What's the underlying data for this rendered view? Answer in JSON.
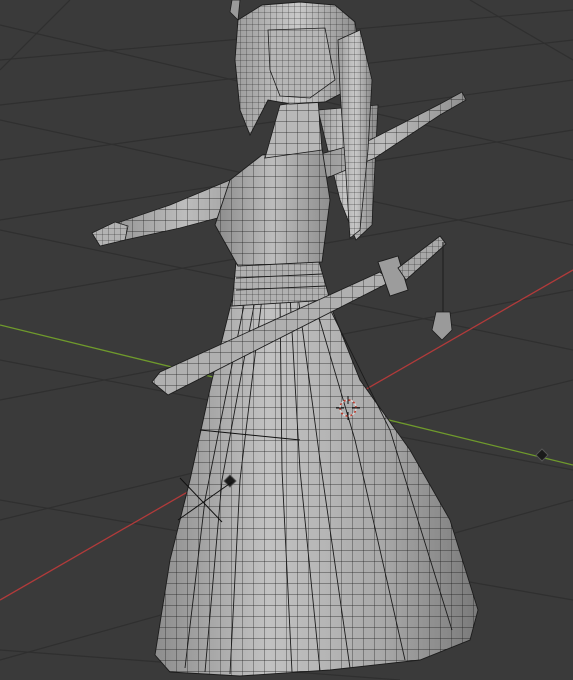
{
  "viewport": {
    "background": "#3a3a3a",
    "grid_color": "#2f2f2f",
    "axis_x_color": "#b13a3a",
    "axis_y_color": "#6f9a2c",
    "mesh_fill": "#a6a6a6",
    "mesh_wire": "#1c1c1c"
  },
  "gizmos": {
    "cursor_icon": "3d-cursor-icon",
    "empty_icons": [
      "empty-diamond-icon",
      "empty-diamond-icon"
    ]
  }
}
